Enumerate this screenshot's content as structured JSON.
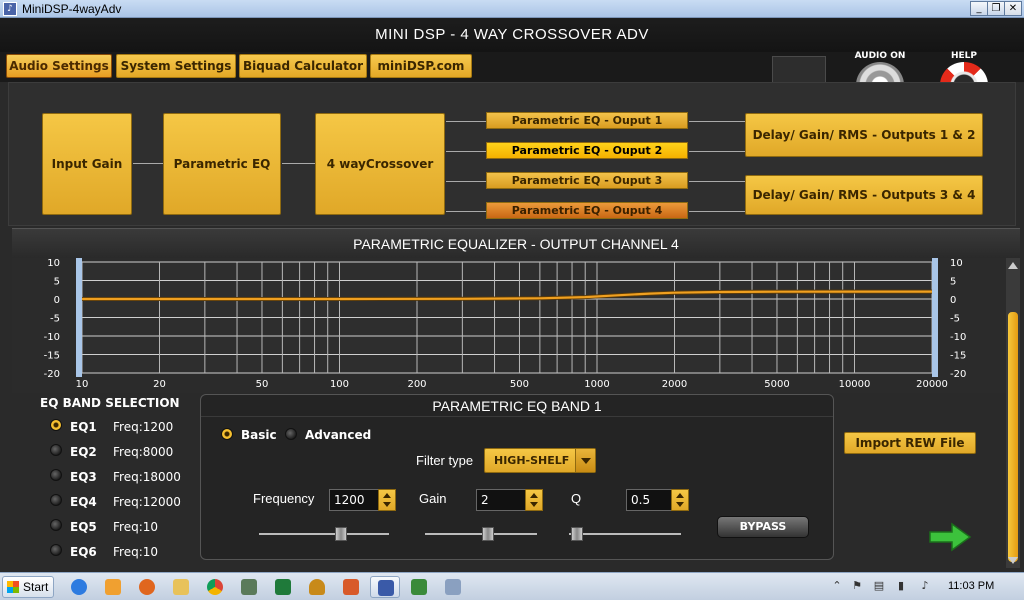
{
  "window": {
    "title": "MiniDSP-4wayAdv",
    "min": "_",
    "max": "❐",
    "close": "✕"
  },
  "header": {
    "title": "MINI DSP - 4 WAY CROSSOVER ADV"
  },
  "tabs": [
    {
      "label": "Audio Settings",
      "active": true
    },
    {
      "label": "System Settings"
    },
    {
      "label": "Biquad Calculator"
    },
    {
      "label": "miniDSP.com"
    }
  ],
  "top_right": {
    "audio_label": "AUDIO ON",
    "help_label": "HELP"
  },
  "flow": {
    "input_gain": "Input Gain",
    "parametric_eq": "Parametric EQ",
    "crossover": "4 wayCrossover",
    "peq_outputs": [
      "Parametric EQ - Ouput 1",
      "Parametric EQ - Ouput 2",
      "Parametric EQ - Ouput 3",
      "Parametric EQ - Ouput 4"
    ],
    "delay_12": "Delay/ Gain/ RMS - Outputs 1 & 2",
    "delay_34": "Delay/ Gain/ RMS - Outputs 3 & 4"
  },
  "eq_panel": {
    "title": "PARAMETRIC EQUALIZER - OUTPUT CHANNEL 4"
  },
  "chart_data": {
    "type": "line",
    "title": "",
    "xlabel": "",
    "ylabel": "",
    "x_scale": "log",
    "xlim": [
      10,
      20000
    ],
    "ylim": [
      -20,
      10
    ],
    "x_ticks": [
      10,
      20,
      50,
      100,
      200,
      500,
      1000,
      2000,
      5000,
      10000,
      20000
    ],
    "y_ticks": [
      10,
      5,
      0,
      -5,
      -10,
      -15,
      -20
    ],
    "grid": true,
    "series": [
      {
        "color": "#f0a020",
        "x": [
          10,
          100,
          300,
          600,
          900,
          1200,
          1600,
          2000,
          3000,
          5000,
          10000,
          20000
        ],
        "y": [
          0,
          0,
          0.05,
          0.2,
          0.5,
          1.0,
          1.45,
          1.7,
          1.9,
          1.97,
          2.0,
          2.0
        ]
      }
    ]
  },
  "band_selection": {
    "title": "EQ BAND SELECTION",
    "bands": [
      {
        "name": "EQ1",
        "freq": "Freq:1200",
        "selected": true
      },
      {
        "name": "EQ2",
        "freq": "Freq:8000"
      },
      {
        "name": "EQ3",
        "freq": "Freq:18000"
      },
      {
        "name": "EQ4",
        "freq": "Freq:12000"
      },
      {
        "name": "EQ5",
        "freq": "Freq:10"
      },
      {
        "name": "EQ6",
        "freq": "Freq:10"
      }
    ]
  },
  "band": {
    "title": "PARAMETRIC EQ BAND 1",
    "mode_basic": "Basic",
    "mode_advanced": "Advanced",
    "filter_type_label": "Filter type",
    "filter_type_value": "HIGH-SHELF",
    "frequency_label": "Frequency",
    "frequency_value": "1200",
    "gain_label": "Gain",
    "gain_value": "2",
    "q_label": "Q",
    "q_value": "0.5",
    "bypass_label": "BYPASS"
  },
  "import_rew": "Import REW File",
  "taskbar": {
    "start": "Start",
    "clock": "11:03 PM"
  },
  "colors": {
    "accent": "#e8b030",
    "selected_output": "#ffd21a",
    "active_output": "#d77a1a",
    "curve": "#f0a020"
  }
}
